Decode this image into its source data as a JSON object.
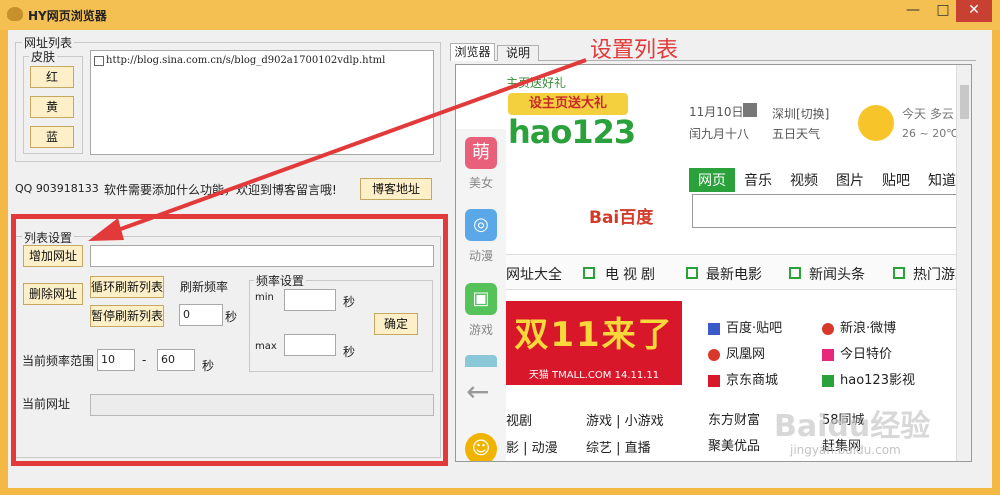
{
  "window": {
    "title": "HY网页浏览器",
    "minimize": "—",
    "maximize": "□",
    "close": "✕"
  },
  "url_list": {
    "group_label": "网址列表",
    "skin_label": "皮肤",
    "skin_red": "红",
    "skin_yellow": "黄",
    "skin_blue": "蓝",
    "url_item": "http://blog.sina.com.cn/s/blog_d902a1700102vdlp.html"
  },
  "info": {
    "qq": "QQ  903918133",
    "message": "软件需要添加什么功能，欢迎到博客留言哦!",
    "blog_button": "博客地址"
  },
  "list_settings": {
    "group_label": "列表设置",
    "add_url": "增加网址",
    "delete_url": "删除网址",
    "loop_refresh": "循环刷新列表",
    "pause_refresh": "暂停刷新列表",
    "refresh_rate": "刷新频率",
    "refresh_value": "0",
    "sec": "秒",
    "freq_group": "频率设置",
    "min": "min",
    "max": "max",
    "confirm": "确定",
    "range_label": "当前频率范围",
    "range_from": "10",
    "range_dash": "-",
    "range_to": "60",
    "current_url": "当前网址"
  },
  "annotation": {
    "text": "设置列表",
    "color": "#e23a3a"
  },
  "tabs": {
    "browser": "浏览器",
    "help": "说明"
  },
  "page": {
    "top_link": "主页送好礼",
    "promo": "设主页送大礼",
    "logo": "hao123",
    "date": "11月10日",
    "lunar": "闰九月十八",
    "city": "深圳[切换]",
    "weather_days": "五日天气",
    "today": "今天 多云",
    "temp": "26 ~ 20℃",
    "search_tabs": [
      "网页",
      "音乐",
      "视频",
      "图片",
      "贴吧",
      "知道"
    ],
    "baidu_logo": "Bai百度",
    "side_items": [
      "美女",
      "动漫",
      "游戏"
    ],
    "side_colors": [
      "#e8607a",
      "#5aa8e8",
      "#56c25a",
      "#f0b400"
    ],
    "nav_tabs": [
      "网址大全",
      "电视剧",
      "最新电影",
      "新闻头条",
      "热门游戏"
    ],
    "banner": "双11来了",
    "banner_sub": "天猫 TMALL.COM 14.11.11",
    "sites": [
      [
        "百度·贴吧",
        "新浪·微博"
      ],
      [
        "凤凰网",
        "今日特价"
      ],
      [
        "京东商城",
        "hao123影视"
      ],
      [
        "东方财富",
        "58同城"
      ],
      [
        "聚美优品",
        "赶集网"
      ]
    ],
    "left_links": [
      [
        "视剧",
        "游戏 | 小游戏"
      ],
      [
        "影 | 动漫",
        "综艺 | 直播"
      ]
    ],
    "watermark": "Baidu经验",
    "watermark_url": "jingyan.baidu.com"
  }
}
